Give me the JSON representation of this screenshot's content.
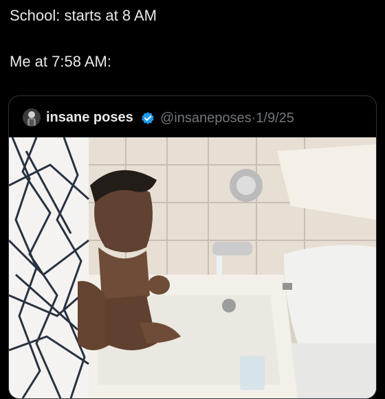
{
  "post": {
    "line1": "School: starts at 8 AM",
    "line2": "Me at 7:58 AM:"
  },
  "quoted": {
    "display_name": "insane poses",
    "handle": "@insaneposes",
    "separator": "·",
    "date": "1/9/25",
    "verified_color": "#1d9bf0"
  },
  "icons": {
    "verified": "verified-badge-icon",
    "avatar": "avatar-image"
  }
}
